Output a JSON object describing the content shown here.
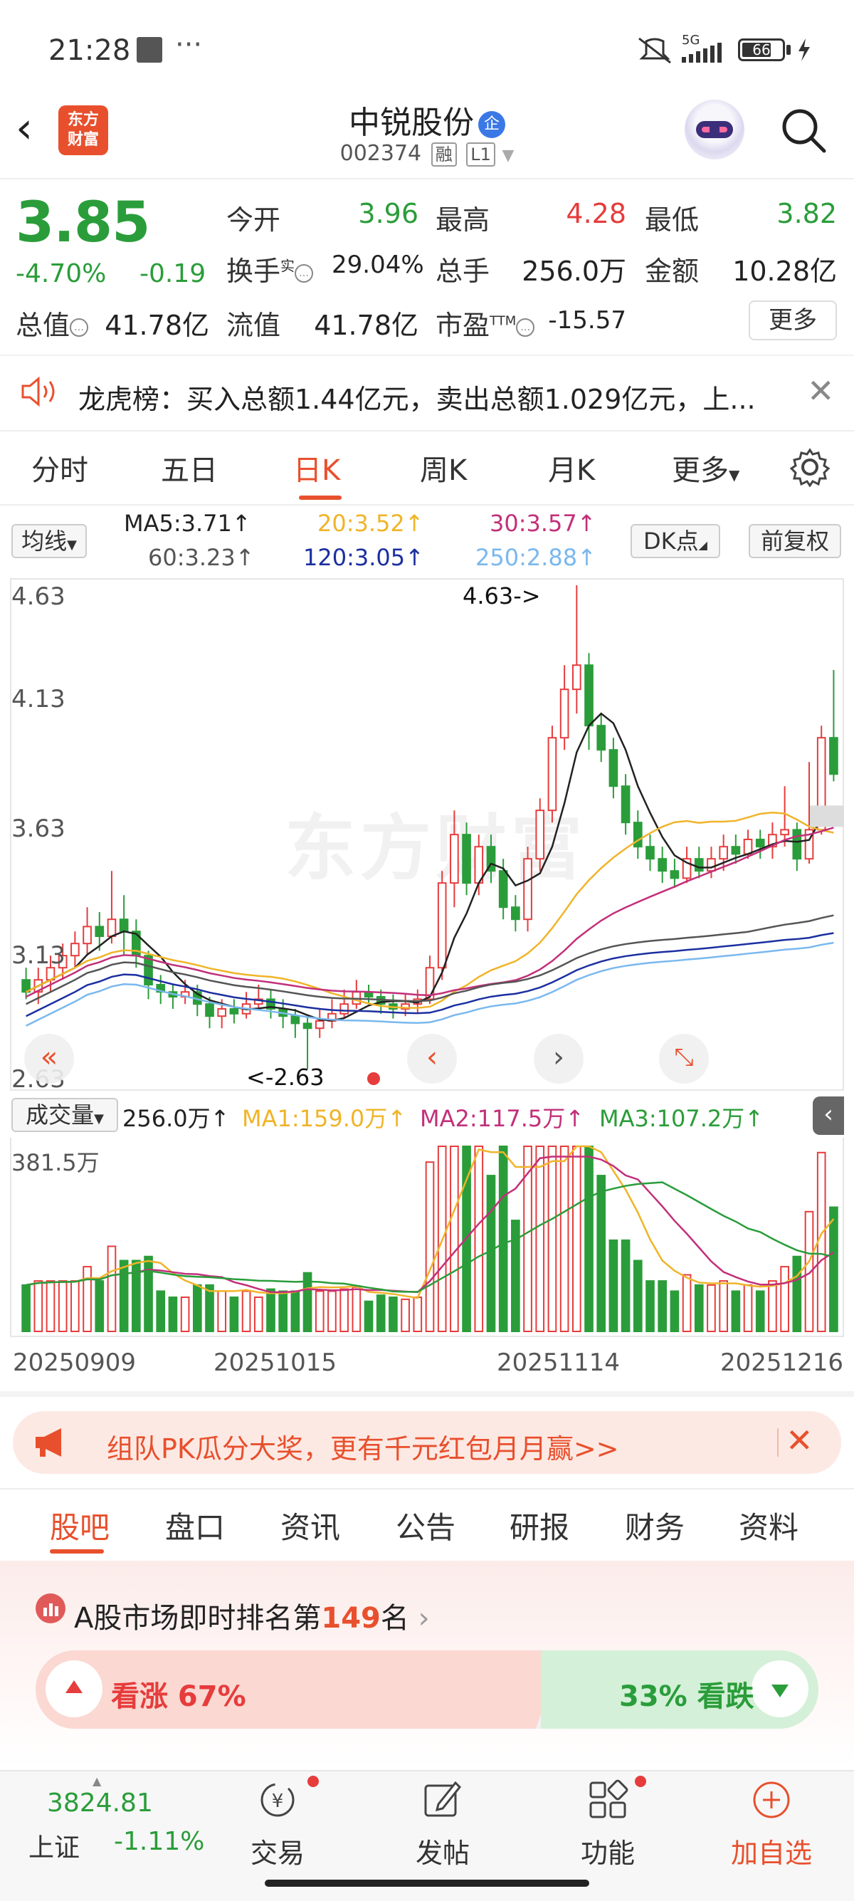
{
  "status_bar": {
    "time": "21:28",
    "dots": "···",
    "network": "5G",
    "battery": "66"
  },
  "header": {
    "back": "‹",
    "logo_line1": "东方",
    "logo_line2": "财富",
    "stock_name": "中锐股份",
    "badge": "企",
    "stock_code": "002374",
    "tag_margin": "融",
    "tag_level": "L1"
  },
  "quote": {
    "price": "3.85",
    "change_pct": "-4.70%",
    "change_amt": "-0.19",
    "open_label": "今开",
    "open": "3.96",
    "high_label": "最高",
    "high": "4.28",
    "low_label": "最低",
    "low": "3.82",
    "turnover_label": "换手",
    "turnover_sup": "实",
    "turnover": "29.04%",
    "volume_label": "总手",
    "volume": "256.0万",
    "amount_label": "金额",
    "amount": "10.28亿",
    "mktcap_label": "总值",
    "mktcap": "41.78亿",
    "float_label": "流值",
    "float_cap": "41.78亿",
    "pe_label": "市盈",
    "pe_sup": "TTM",
    "pe": "-15.57",
    "more": "更多"
  },
  "notice": {
    "text": "龙虎榜：买入总额1.44亿元，卖出总额1.029亿元，上...",
    "close": "✕"
  },
  "chart_tabs": [
    "分时",
    "五日",
    "日K",
    "周K",
    "月K",
    "更多"
  ],
  "ma_legend": {
    "selector": "均线",
    "ma5": "MA5:3.71↑",
    "ma20": "20:3.52↑",
    "ma30": "30:3.57↑",
    "ma60": "60:3.23↑",
    "ma120": "120:3.05↑",
    "ma250": "250:2.88↑",
    "dk": "DK点",
    "adjust": "前复权"
  },
  "price_chart": {
    "y_labels": [
      "4.63",
      "4.13",
      "3.63",
      "3.13",
      "2.63"
    ],
    "max_marker": "4.63->",
    "min_marker": "<-2.63",
    "watermark": "东方财富"
  },
  "volume_legend": {
    "selector": "成交量",
    "vol": "256.0万↑",
    "ma1": "MA1:159.0万↑",
    "ma2": "MA2:117.5万↑",
    "ma3": "MA3:107.2万↑",
    "max": "381.5万"
  },
  "dates": [
    "20250909",
    "20251015",
    "20251114",
    "20251216"
  ],
  "colors": {
    "up": "#e63c3c",
    "down": "#2a9d3a",
    "accent": "#e8502d",
    "ma5": "#222222",
    "ma20": "#f0b429",
    "ma30": "#c2307a",
    "ma60": "#555555",
    "ma120": "#1c2fa0",
    "ma250": "#7ab8ee"
  },
  "chart_data": {
    "type": "candlestick",
    "ylim": [
      2.63,
      4.63
    ],
    "candles": [
      [
        3.0,
        2.95,
        3.05,
        2.92
      ],
      [
        2.95,
        3.0,
        3.05,
        2.9
      ],
      [
        3.0,
        3.05,
        3.1,
        2.95
      ],
      [
        3.05,
        3.1,
        3.15,
        3.0
      ],
      [
        3.1,
        3.15,
        3.2,
        3.05
      ],
      [
        3.15,
        3.22,
        3.3,
        3.1
      ],
      [
        3.22,
        3.18,
        3.28,
        3.12
      ],
      [
        3.18,
        3.25,
        3.45,
        3.15
      ],
      [
        3.25,
        3.2,
        3.35,
        3.1
      ],
      [
        3.2,
        3.1,
        3.25,
        3.05
      ],
      [
        3.1,
        2.98,
        3.12,
        2.92
      ],
      [
        2.98,
        2.95,
        3.02,
        2.9
      ],
      [
        2.95,
        2.93,
        2.98,
        2.88
      ],
      [
        2.93,
        2.95,
        3.0,
        2.9
      ],
      [
        2.95,
        2.9,
        2.98,
        2.85
      ],
      [
        2.9,
        2.85,
        2.93,
        2.8
      ],
      [
        2.85,
        2.88,
        2.92,
        2.8
      ],
      [
        2.88,
        2.86,
        2.92,
        2.82
      ],
      [
        2.86,
        2.9,
        2.95,
        2.84
      ],
      [
        2.9,
        2.92,
        2.98,
        2.88
      ],
      [
        2.92,
        2.88,
        2.96,
        2.84
      ],
      [
        2.88,
        2.85,
        2.92,
        2.8
      ],
      [
        2.85,
        2.82,
        2.88,
        2.76
      ],
      [
        2.82,
        2.8,
        2.85,
        2.63
      ],
      [
        2.8,
        2.83,
        2.88,
        2.76
      ],
      [
        2.83,
        2.86,
        2.92,
        2.8
      ],
      [
        2.86,
        2.9,
        2.96,
        2.84
      ],
      [
        2.9,
        2.95,
        3.0,
        2.88
      ],
      [
        2.95,
        2.93,
        2.98,
        2.9
      ],
      [
        2.93,
        2.9,
        2.96,
        2.86
      ],
      [
        2.9,
        2.88,
        2.94,
        2.84
      ],
      [
        2.88,
        2.9,
        2.94,
        2.85
      ],
      [
        2.9,
        2.92,
        2.96,
        2.86
      ],
      [
        2.92,
        3.05,
        3.1,
        2.9
      ],
      [
        3.05,
        3.4,
        3.45,
        3.0
      ],
      [
        3.4,
        3.6,
        3.7,
        3.3
      ],
      [
        3.6,
        3.4,
        3.65,
        3.35
      ],
      [
        3.4,
        3.55,
        3.6,
        3.35
      ],
      [
        3.55,
        3.45,
        3.6,
        3.4
      ],
      [
        3.45,
        3.3,
        3.5,
        3.25
      ],
      [
        3.3,
        3.25,
        3.35,
        3.2
      ],
      [
        3.25,
        3.5,
        3.55,
        3.2
      ],
      [
        3.5,
        3.7,
        3.75,
        3.45
      ],
      [
        3.7,
        4.0,
        4.05,
        3.65
      ],
      [
        4.0,
        4.2,
        4.3,
        3.95
      ],
      [
        4.2,
        4.3,
        4.63,
        4.1
      ],
      [
        4.3,
        4.05,
        4.35,
        3.95
      ],
      [
        4.05,
        3.95,
        4.1,
        3.9
      ],
      [
        3.95,
        3.8,
        4.0,
        3.75
      ],
      [
        3.8,
        3.65,
        3.85,
        3.6
      ],
      [
        3.65,
        3.55,
        3.7,
        3.5
      ],
      [
        3.55,
        3.5,
        3.6,
        3.45
      ],
      [
        3.5,
        3.45,
        3.55,
        3.4
      ],
      [
        3.45,
        3.42,
        3.5,
        3.38
      ],
      [
        3.42,
        3.5,
        3.55,
        3.4
      ],
      [
        3.5,
        3.45,
        3.55,
        3.42
      ],
      [
        3.45,
        3.5,
        3.55,
        3.42
      ],
      [
        3.5,
        3.55,
        3.6,
        3.45
      ],
      [
        3.55,
        3.52,
        3.6,
        3.48
      ],
      [
        3.52,
        3.58,
        3.62,
        3.5
      ],
      [
        3.58,
        3.55,
        3.62,
        3.5
      ],
      [
        3.55,
        3.6,
        3.65,
        3.5
      ],
      [
        3.6,
        3.62,
        3.8,
        3.55
      ],
      [
        3.62,
        3.5,
        3.65,
        3.45
      ],
      [
        3.5,
        3.62,
        3.9,
        3.48
      ],
      [
        3.62,
        4.0,
        4.05,
        3.6
      ],
      [
        4.0,
        3.85,
        4.28,
        3.82
      ]
    ],
    "volume_max": 381.5
  },
  "bottom_nav": {
    "index_value": "3824.81",
    "index_name": "上证",
    "index_pct": "-1.11%",
    "items": [
      "交易",
      "发帖",
      "功能",
      "加自选"
    ]
  },
  "promo": {
    "text": "组队PK瓜分大奖，更有千元红包月月赢>>",
    "close": "✕"
  },
  "content_tabs": [
    "股吧",
    "盘口",
    "资讯",
    "公告",
    "研报",
    "财务",
    "资料"
  ],
  "rank": {
    "prefix": "A股市场即时排名第",
    "number": "149",
    "suffix": "名",
    "arrow": "›"
  },
  "vote": {
    "up_label": "看涨 67%",
    "down_label": "33% 看跌"
  }
}
